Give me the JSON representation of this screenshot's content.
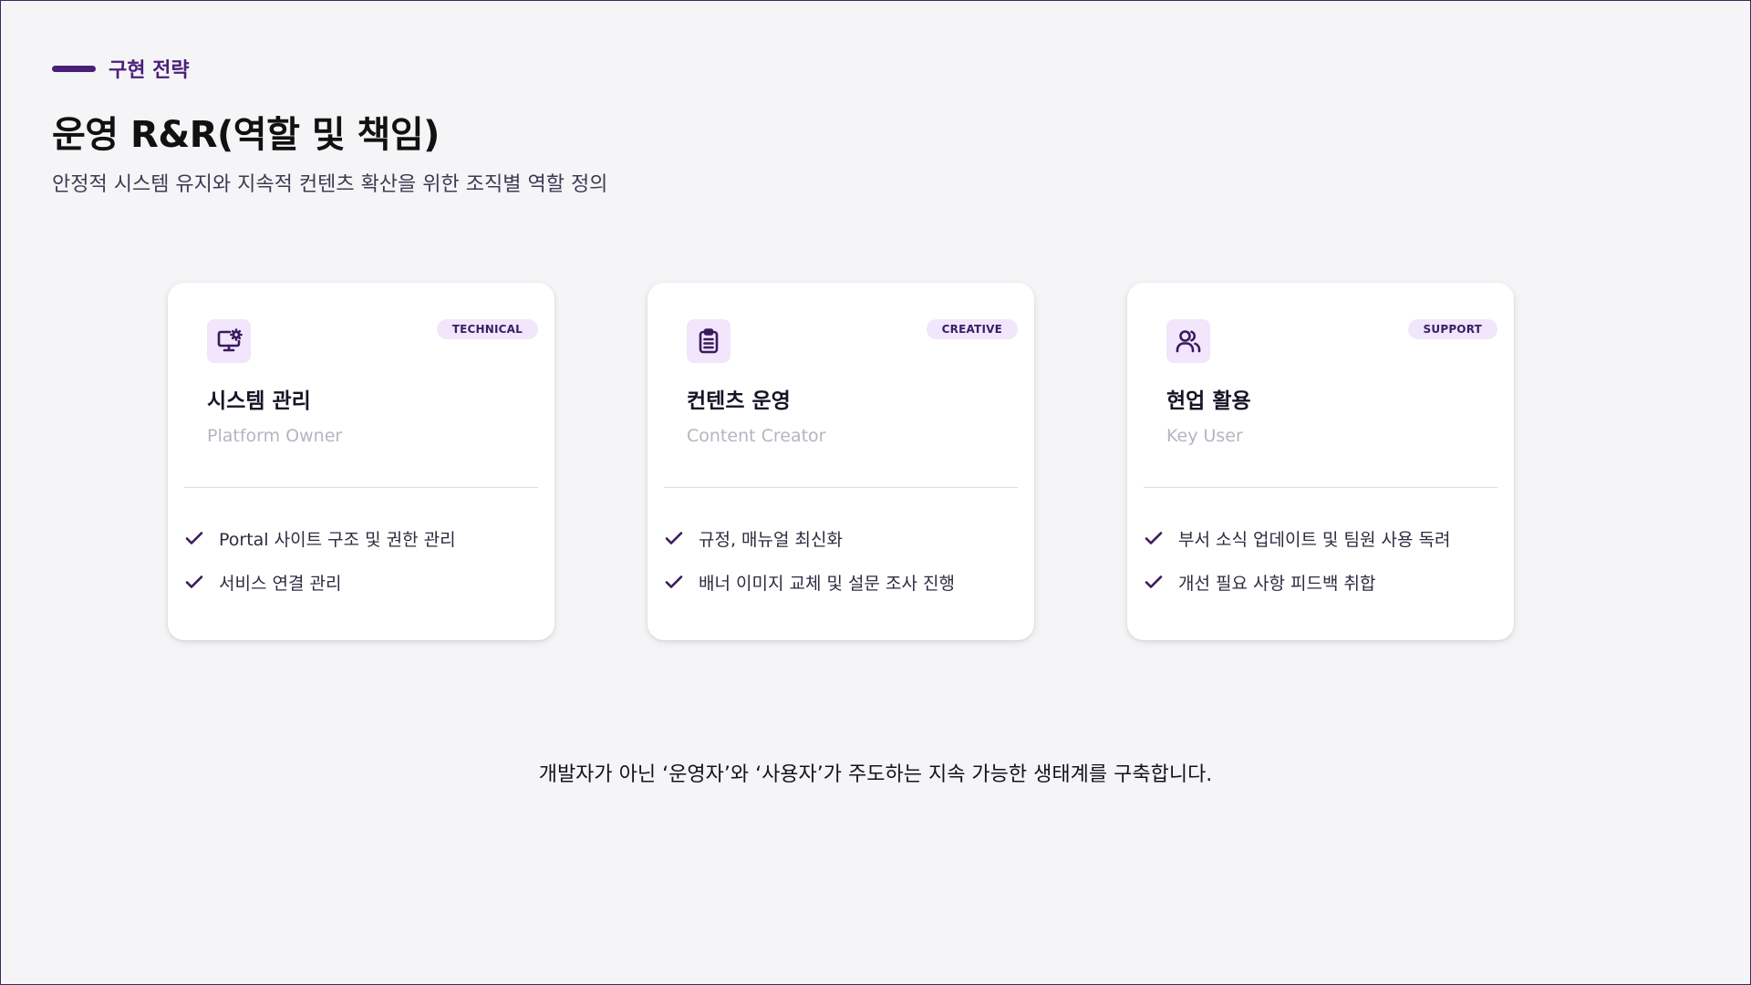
{
  "header": {
    "eyebrow": "구현 전략",
    "title": "운영 R&R(역할 및 책임)",
    "subtitle": "안정적 시스템 유지와 지속적 컨텐츠 확산을 위한 조직별 역할 정의"
  },
  "cards": [
    {
      "icon": "monitor-gear-icon",
      "badge": "TECHNICAL",
      "title": "시스템 관리",
      "role": "Platform Owner",
      "items": [
        "Portal 사이트 구조 및 권한 관리",
        "서비스 연결 관리"
      ]
    },
    {
      "icon": "clipboard-list-icon",
      "badge": "CREATIVE",
      "title": "컨텐츠 운영",
      "role": "Content Creator",
      "items": [
        "규정, 매뉴얼 최신화",
        "배너 이미지 교체 및 설문 조사 진행"
      ]
    },
    {
      "icon": "users-icon",
      "badge": "SUPPORT",
      "title": "현업 활용",
      "role": "Key User",
      "items": [
        "부서 소식 업데이트 및 팀원 사용 독려",
        "개선 필요 사항 피드백 취합"
      ]
    }
  ],
  "footer": {
    "note": "개발자가 아닌 ‘운영자’와 ‘사용자’가 주도하는 지속 가능한 생태계를 구축합니다."
  },
  "colors": {
    "accent": "#4a1f7a",
    "badge_bg": "#f1e6fb",
    "background": "#f5f5f8"
  }
}
